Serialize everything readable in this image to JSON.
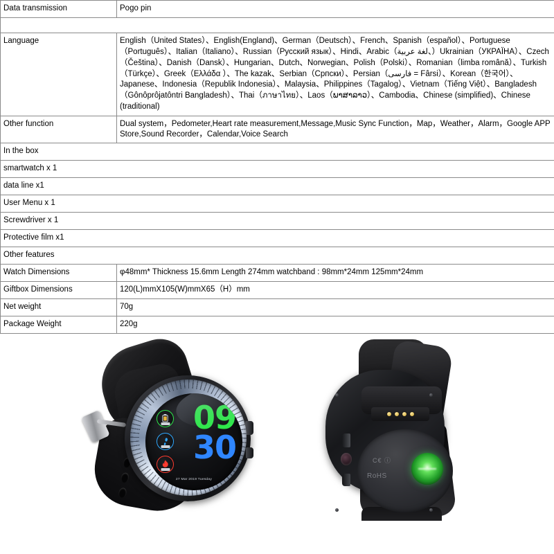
{
  "table": {
    "rows": [
      {
        "type": "pair",
        "label": "Data transmission",
        "value": "Pogo pin"
      },
      {
        "type": "spacer",
        "label": "",
        "value": ""
      },
      {
        "type": "pair",
        "label": "Language",
        "value": "English（United States）、English(England)、German（Deutsch）、French、Spanish（español）、Portuguese（Português）、Italian（Italiano）、Russian（Русский язык）、Hindi、Arabic（لغة عربية、）Ukrainian（УКРАЇНА）、Czech（Čeština）、Danish（Dansk）、Hungarian、Dutch、Norwegian、Polish（Polski）、Romanian（limba română）、Turkish（Türkçe）、Greek（Ελλάδα ）、The kazak、Serbian（Српски）、Persian（فارسی = Fârsi）、Korean（한국어）、Japanese、Indonesia（Republik Indonesia）、Malaysia、Philippines（Tagalog）、Vietnam（Tiếng Việt）、Bangladesh（Gônôprôjatôntri Bangladesh）、Thai（ภาษาไทย）、Laos（ພາສາລາວ）、Cambodia、Chinese (simplified)、Chinese (traditional)"
      },
      {
        "type": "pair",
        "label": "Other function",
        "value": "Dual system，Pedometer,Heart rate measurement,Message,Music Sync Function，Map，Weather，Alarm，Google APP Store,Sound Recorder，Calendar,Voice Search"
      },
      {
        "type": "full",
        "label": "In the box",
        "value": ""
      },
      {
        "type": "full",
        "label": "smartwatch x 1",
        "value": ""
      },
      {
        "type": "full",
        "label": "data line x1",
        "value": ""
      },
      {
        "type": "full",
        "label": "User Menu x 1",
        "value": ""
      },
      {
        "type": "full",
        "label": "Screwdriver x 1",
        "value": ""
      },
      {
        "type": "full",
        "label": "Protective film x1",
        "value": ""
      },
      {
        "type": "full",
        "label": "Other features",
        "value": ""
      },
      {
        "type": "pair",
        "label": "Watch Dimensions",
        "value": "φ48mm*  Thickness 15.6mm  Length 274mm   watchband : 98mm*24mm    125mm*24mm"
      },
      {
        "type": "pair",
        "label": "Giftbox Dimensions",
        "value": "120(L)mmX105(W)mmX65（H）mm"
      },
      {
        "type": "pair",
        "label": "Net weight",
        "value": "70g"
      },
      {
        "type": "pair",
        "label": "Package Weight",
        "value": "220g"
      }
    ]
  },
  "photo": {
    "alt": "smartwatch-product-photo",
    "front_watch": {
      "hours": "09",
      "minutes": "30",
      "date": "27 Mar 2019 Tuesday",
      "hours_color": "#2ee84a",
      "minutes_color": "#2f86ff",
      "icons": [
        {
          "name": "battery-icon",
          "accent": "#2ee84a"
        },
        {
          "name": "footsteps-icon",
          "accent": "#2fa8ff"
        },
        {
          "name": "calories-flame-icon",
          "accent": "#ff3b2f"
        }
      ]
    },
    "back_watch": {
      "ce_mark": "C€ ⓘ",
      "rohs_mark": "RoHS",
      "pogo_pin_count": 4,
      "sensor_color": "#2ee84a"
    }
  }
}
